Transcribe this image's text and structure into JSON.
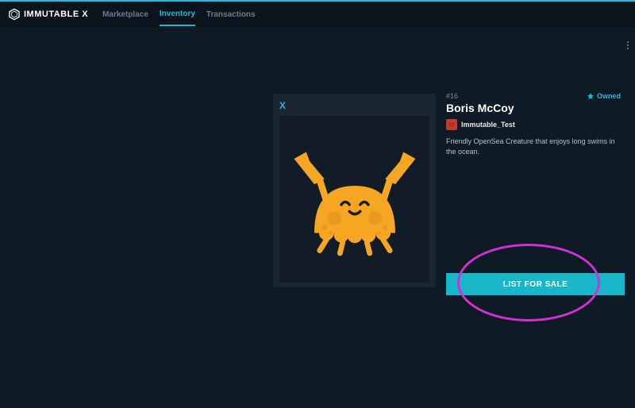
{
  "header": {
    "brand": "IMMUTABLE X",
    "nav": {
      "marketplace": "Marketplace",
      "inventory": "Inventory",
      "transactions": "Transactions"
    }
  },
  "asset": {
    "id_label": "#16",
    "title": "Boris McCoy",
    "owned_label": "Owned",
    "collection_name": "Immutable_Test",
    "description": "Friendly OpenSea Creature that enjoys long swims in the ocean."
  },
  "actions": {
    "list_for_sale": "LIST FOR SALE"
  },
  "icons": {
    "card_mark": "X"
  },
  "colors": {
    "accent": "#1fb6d9",
    "button": "#17b6c9",
    "highlight": "#d030d6",
    "crab_body": "#f6a623",
    "crab_dark": "#e08f10"
  }
}
